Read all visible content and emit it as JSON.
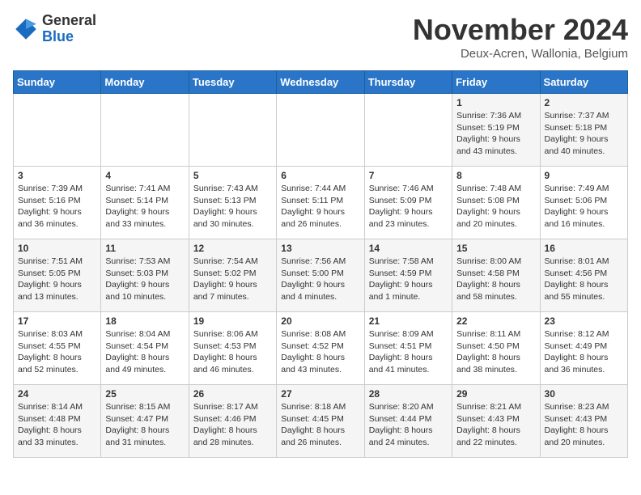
{
  "logo": {
    "general": "General",
    "blue": "Blue"
  },
  "header": {
    "month": "November 2024",
    "location": "Deux-Acren, Wallonia, Belgium"
  },
  "weekdays": [
    "Sunday",
    "Monday",
    "Tuesday",
    "Wednesday",
    "Thursday",
    "Friday",
    "Saturday"
  ],
  "weeks": [
    [
      {
        "day": "",
        "info": ""
      },
      {
        "day": "",
        "info": ""
      },
      {
        "day": "",
        "info": ""
      },
      {
        "day": "",
        "info": ""
      },
      {
        "day": "",
        "info": ""
      },
      {
        "day": "1",
        "info": "Sunrise: 7:36 AM\nSunset: 5:19 PM\nDaylight: 9 hours and 43 minutes."
      },
      {
        "day": "2",
        "info": "Sunrise: 7:37 AM\nSunset: 5:18 PM\nDaylight: 9 hours and 40 minutes."
      }
    ],
    [
      {
        "day": "3",
        "info": "Sunrise: 7:39 AM\nSunset: 5:16 PM\nDaylight: 9 hours and 36 minutes."
      },
      {
        "day": "4",
        "info": "Sunrise: 7:41 AM\nSunset: 5:14 PM\nDaylight: 9 hours and 33 minutes."
      },
      {
        "day": "5",
        "info": "Sunrise: 7:43 AM\nSunset: 5:13 PM\nDaylight: 9 hours and 30 minutes."
      },
      {
        "day": "6",
        "info": "Sunrise: 7:44 AM\nSunset: 5:11 PM\nDaylight: 9 hours and 26 minutes."
      },
      {
        "day": "7",
        "info": "Sunrise: 7:46 AM\nSunset: 5:09 PM\nDaylight: 9 hours and 23 minutes."
      },
      {
        "day": "8",
        "info": "Sunrise: 7:48 AM\nSunset: 5:08 PM\nDaylight: 9 hours and 20 minutes."
      },
      {
        "day": "9",
        "info": "Sunrise: 7:49 AM\nSunset: 5:06 PM\nDaylight: 9 hours and 16 minutes."
      }
    ],
    [
      {
        "day": "10",
        "info": "Sunrise: 7:51 AM\nSunset: 5:05 PM\nDaylight: 9 hours and 13 minutes."
      },
      {
        "day": "11",
        "info": "Sunrise: 7:53 AM\nSunset: 5:03 PM\nDaylight: 9 hours and 10 minutes."
      },
      {
        "day": "12",
        "info": "Sunrise: 7:54 AM\nSunset: 5:02 PM\nDaylight: 9 hours and 7 minutes."
      },
      {
        "day": "13",
        "info": "Sunrise: 7:56 AM\nSunset: 5:00 PM\nDaylight: 9 hours and 4 minutes."
      },
      {
        "day": "14",
        "info": "Sunrise: 7:58 AM\nSunset: 4:59 PM\nDaylight: 9 hours and 1 minute."
      },
      {
        "day": "15",
        "info": "Sunrise: 8:00 AM\nSunset: 4:58 PM\nDaylight: 8 hours and 58 minutes."
      },
      {
        "day": "16",
        "info": "Sunrise: 8:01 AM\nSunset: 4:56 PM\nDaylight: 8 hours and 55 minutes."
      }
    ],
    [
      {
        "day": "17",
        "info": "Sunrise: 8:03 AM\nSunset: 4:55 PM\nDaylight: 8 hours and 52 minutes."
      },
      {
        "day": "18",
        "info": "Sunrise: 8:04 AM\nSunset: 4:54 PM\nDaylight: 8 hours and 49 minutes."
      },
      {
        "day": "19",
        "info": "Sunrise: 8:06 AM\nSunset: 4:53 PM\nDaylight: 8 hours and 46 minutes."
      },
      {
        "day": "20",
        "info": "Sunrise: 8:08 AM\nSunset: 4:52 PM\nDaylight: 8 hours and 43 minutes."
      },
      {
        "day": "21",
        "info": "Sunrise: 8:09 AM\nSunset: 4:51 PM\nDaylight: 8 hours and 41 minutes."
      },
      {
        "day": "22",
        "info": "Sunrise: 8:11 AM\nSunset: 4:50 PM\nDaylight: 8 hours and 38 minutes."
      },
      {
        "day": "23",
        "info": "Sunrise: 8:12 AM\nSunset: 4:49 PM\nDaylight: 8 hours and 36 minutes."
      }
    ],
    [
      {
        "day": "24",
        "info": "Sunrise: 8:14 AM\nSunset: 4:48 PM\nDaylight: 8 hours and 33 minutes."
      },
      {
        "day": "25",
        "info": "Sunrise: 8:15 AM\nSunset: 4:47 PM\nDaylight: 8 hours and 31 minutes."
      },
      {
        "day": "26",
        "info": "Sunrise: 8:17 AM\nSunset: 4:46 PM\nDaylight: 8 hours and 28 minutes."
      },
      {
        "day": "27",
        "info": "Sunrise: 8:18 AM\nSunset: 4:45 PM\nDaylight: 8 hours and 26 minutes."
      },
      {
        "day": "28",
        "info": "Sunrise: 8:20 AM\nSunset: 4:44 PM\nDaylight: 8 hours and 24 minutes."
      },
      {
        "day": "29",
        "info": "Sunrise: 8:21 AM\nSunset: 4:43 PM\nDaylight: 8 hours and 22 minutes."
      },
      {
        "day": "30",
        "info": "Sunrise: 8:23 AM\nSunset: 4:43 PM\nDaylight: 8 hours and 20 minutes."
      }
    ]
  ]
}
